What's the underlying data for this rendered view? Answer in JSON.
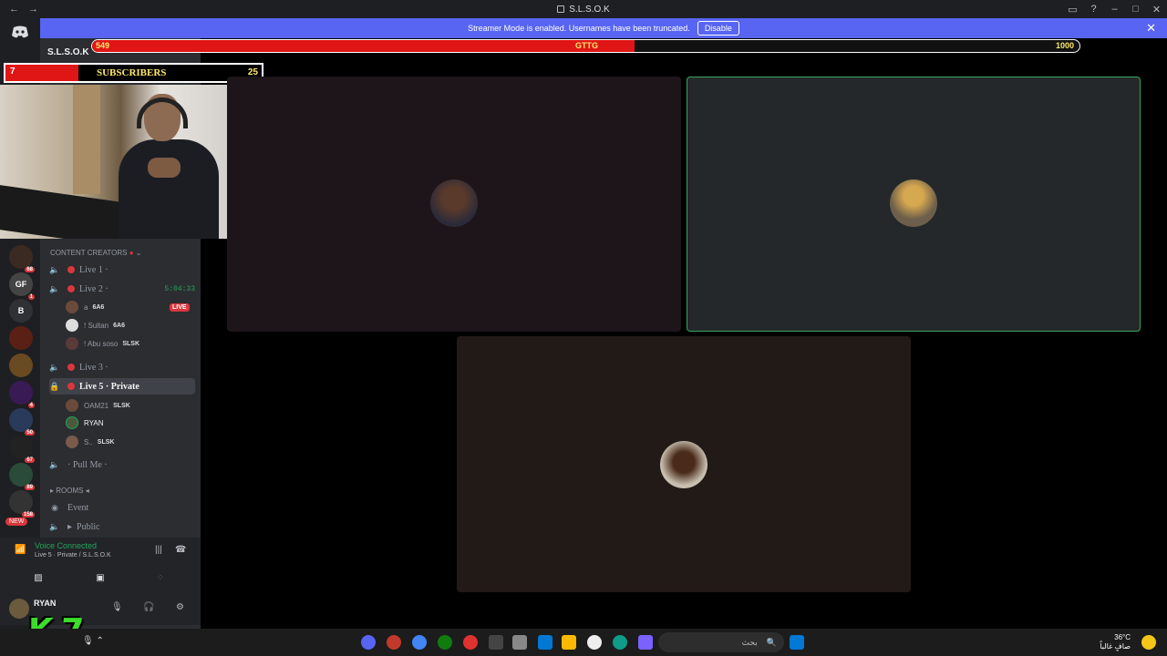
{
  "window": {
    "title": "S.L.S.O.K",
    "nav_back": "←",
    "nav_forward": "→",
    "controls": [
      "▭",
      "?",
      "–",
      "□",
      "✕"
    ]
  },
  "banner": {
    "text": "Streamer Mode is enabled. Usernames have been truncated.",
    "disable_label": "Disable",
    "close": "✕"
  },
  "goal_bar": {
    "current": "549",
    "label": "GTTG",
    "target": "1000",
    "progress": 0.549
  },
  "subscribers": {
    "left_value": "7",
    "label": "SUBSCRIBERS",
    "right_value": "25"
  },
  "server_name": "S.L.S.O.K",
  "category": "CONTENT CREATORS",
  "channels": [
    {
      "name": "Live 1 ·",
      "time": ""
    },
    {
      "name": "Live 2 ·",
      "time": "5:04:33"
    },
    {
      "name": "Live 3 ·",
      "time": ""
    },
    {
      "name": "Live 5 · Private",
      "time": ""
    },
    {
      "name": "· Pull Me ·",
      "time": ""
    }
  ],
  "live2_members": [
    {
      "name": "a",
      "tag": "6A6",
      "live": "LIVE"
    },
    {
      "name": "! Sultan",
      "tag": "6A6",
      "live": ""
    },
    {
      "name": "! Abu soso",
      "tag": "SLSK",
      "live": ""
    }
  ],
  "live5_members": [
    {
      "name": "OAM21",
      "tag": "SLSK"
    },
    {
      "name": "RYAN",
      "tag": ""
    },
    {
      "name": "S..",
      "tag": "SLSK"
    }
  ],
  "rooms_category": "ROOMS",
  "other_channels": [
    "Event",
    "Public"
  ],
  "server_icons": [
    {
      "label": "",
      "badge": "68"
    },
    {
      "label": "GF",
      "badge": "1"
    },
    {
      "label": "B",
      "badge": ""
    },
    {
      "label": "",
      "badge": ""
    },
    {
      "label": "",
      "badge": ""
    },
    {
      "label": "",
      "badge": "4"
    },
    {
      "label": "",
      "badge": "50"
    },
    {
      "label": "",
      "badge": "67"
    },
    {
      "label": "",
      "badge": "89"
    },
    {
      "label": "",
      "badge": "158"
    }
  ],
  "new_badge": "NEW",
  "voice": {
    "status": "Voice Connected",
    "channel": "Live 5 · Private / S.L.S.O.K"
  },
  "user": {
    "name": "RYAN"
  },
  "overlay_logo": "K 7",
  "taskbar": {
    "search_text": "بحث",
    "weather": "36°C",
    "weather_desc": "صافٍ غالباً"
  },
  "colors": {
    "accent": "#5865f2",
    "live_red": "#da373c",
    "connected_green": "#23a55a",
    "tile1": "#1d1519",
    "tile2": "#24282a",
    "tile3": "#221a17",
    "speaking_border": "#3ba55c"
  }
}
